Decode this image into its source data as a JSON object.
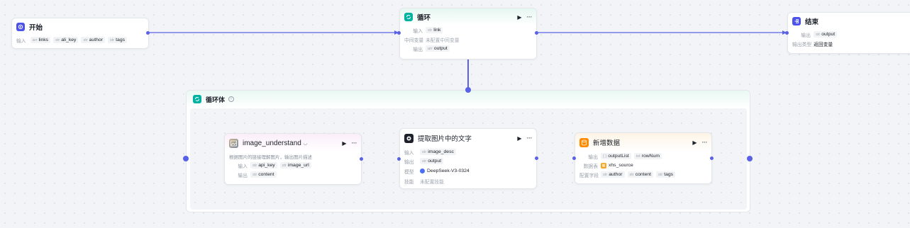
{
  "start": {
    "title": "开始",
    "input_label": "输入",
    "inputs": [
      {
        "type": "arr",
        "name": "links"
      },
      {
        "type": "str",
        "name": "ali_key"
      },
      {
        "type": "str",
        "name": "author"
      },
      {
        "type": "str",
        "name": "tags"
      }
    ]
  },
  "loop": {
    "title": "循环",
    "input_label": "输入",
    "input": {
      "type": "str",
      "name": "link"
    },
    "mid_label": "中间变量",
    "mid_value": "未配置中间变量",
    "output_label": "输出",
    "output": {
      "type": "arr",
      "name": "output"
    }
  },
  "end": {
    "title": "结束",
    "output_label": "输出",
    "output": {
      "type": "str",
      "name": "output"
    },
    "type_label": "输出类型",
    "type_value": "返回变量"
  },
  "loop_body": {
    "title": "循环体",
    "info": "i"
  },
  "image_understand": {
    "title": "image_understand",
    "badge": "◡",
    "description": "根据图片的链接理解图片，输出图片描述",
    "input_label": "输入",
    "inputs": [
      {
        "type": "str",
        "name": "api_key"
      },
      {
        "type": "str",
        "name": "image_url"
      }
    ],
    "output_label": "输出",
    "output": {
      "type": "str",
      "name": "content"
    }
  },
  "extract": {
    "title": "提取图片中的文字",
    "input_label": "输入",
    "input": {
      "type": "str",
      "name": "image_desc"
    },
    "output_label": "输出",
    "output": {
      "type": "str",
      "name": "output"
    },
    "model_label": "模型",
    "model": "DeepSeek-V3-0324",
    "skill_label": "技能",
    "skill": "未配置技能"
  },
  "add_data": {
    "title": "新增数据",
    "output_label": "输出",
    "outputs": [
      {
        "type": "{ }",
        "name": "outputList"
      },
      {
        "type": "int",
        "name": "rowNum"
      }
    ],
    "table_label": "数据表",
    "table": "xhs_source",
    "fields_label": "配置字段",
    "fields": [
      {
        "type": "str",
        "name": "author"
      },
      {
        "type": "str",
        "name": "content"
      },
      {
        "type": "str",
        "name": "tags"
      }
    ]
  },
  "icons": {
    "play": "▶",
    "more": "···"
  },
  "colors": {
    "edge": "#5961e6",
    "start_icon": "#4d53e8",
    "loop_icon": "#00b2a1",
    "end_icon": "#4d53e8",
    "add_data_icon": "#ff8a00"
  }
}
